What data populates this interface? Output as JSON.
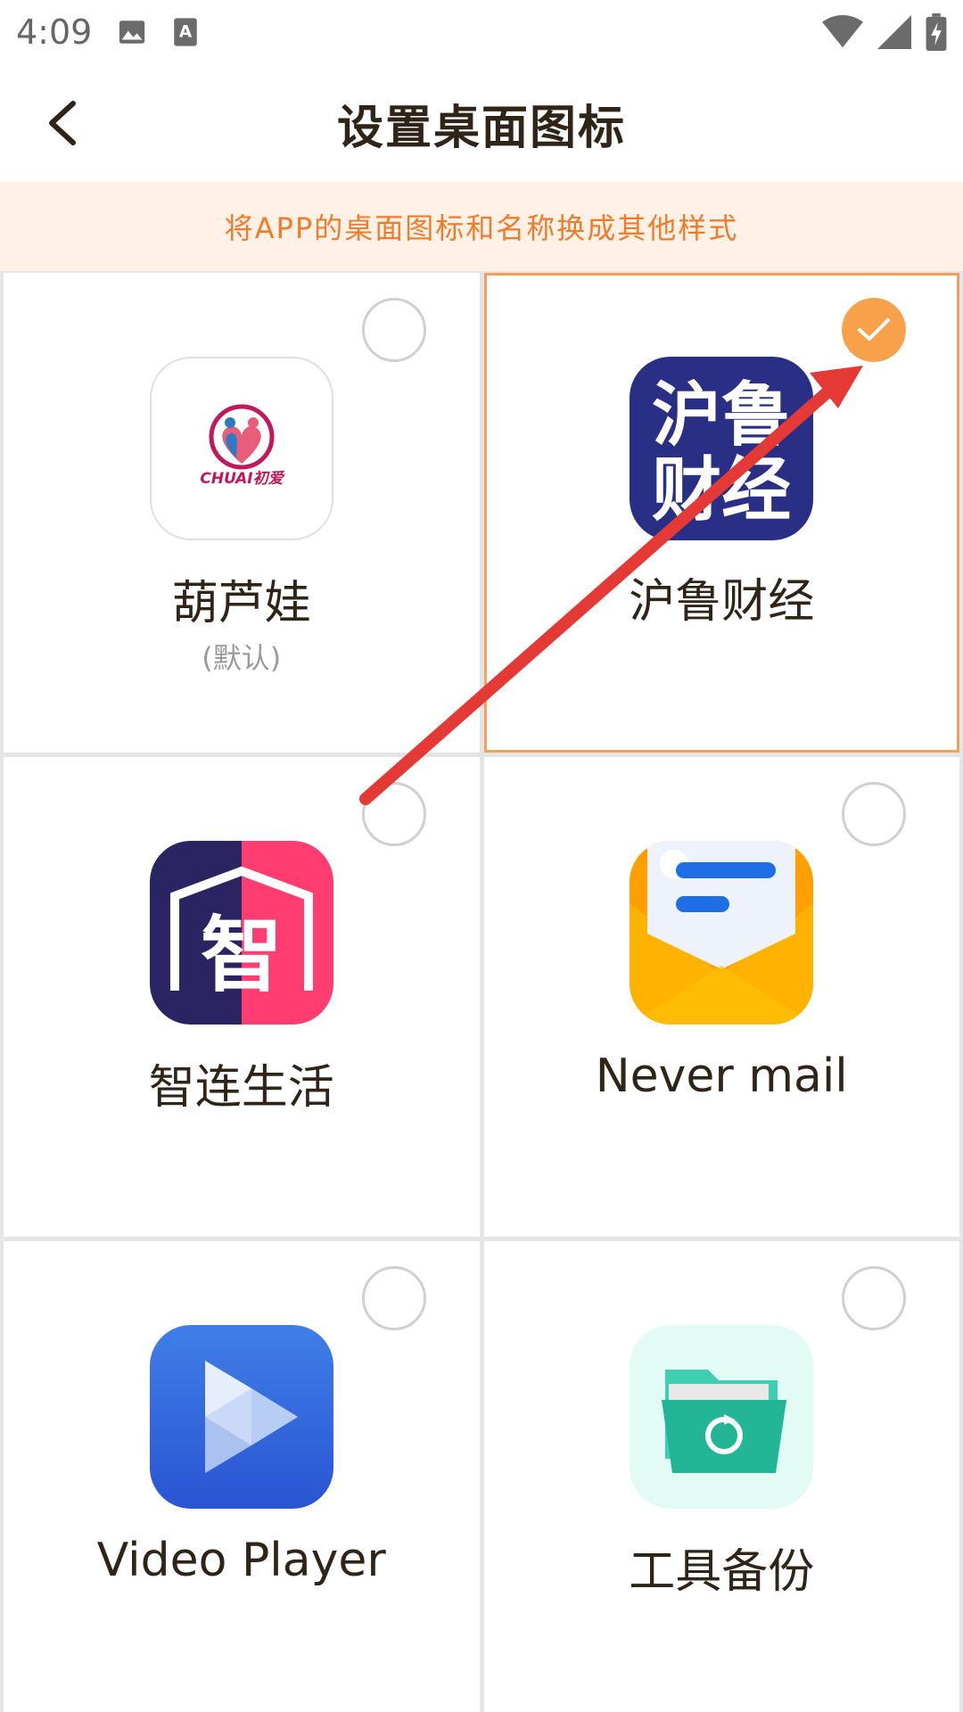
{
  "status_bar": {
    "time": "4:09",
    "icons": [
      "image-icon",
      "text-a-icon",
      "wifi-icon",
      "signal-icon",
      "battery-charging-icon"
    ]
  },
  "header": {
    "back_icon": "chevron-left-icon",
    "title": "设置桌面图标"
  },
  "banner": {
    "text": "将APP的桌面图标和名称换成其他样式"
  },
  "options": [
    {
      "name": "葫芦娃",
      "sub": "(默认)",
      "icon": "chuai-logo-icon",
      "icon_text": "CHUAI初爱",
      "selected": false
    },
    {
      "name": "沪鲁财经",
      "icon": "hulu-caijing-icon",
      "icon_text_1": "沪鲁",
      "icon_text_2": "财经",
      "selected": true
    },
    {
      "name": "智连生活",
      "icon": "zhilian-icon",
      "icon_text": "智",
      "selected": false
    },
    {
      "name": "Never mail",
      "icon": "mail-envelope-icon",
      "selected": false
    },
    {
      "name": "Video Player",
      "icon": "play-icon",
      "selected": false
    },
    {
      "name": "工具备份",
      "icon": "folder-backup-icon",
      "selected": false
    }
  ],
  "colors": {
    "accent": "#f7a24b",
    "banner_bg": "#fff1e6",
    "banner_text": "#f07b2b",
    "annotation_arrow": "#e53935"
  }
}
